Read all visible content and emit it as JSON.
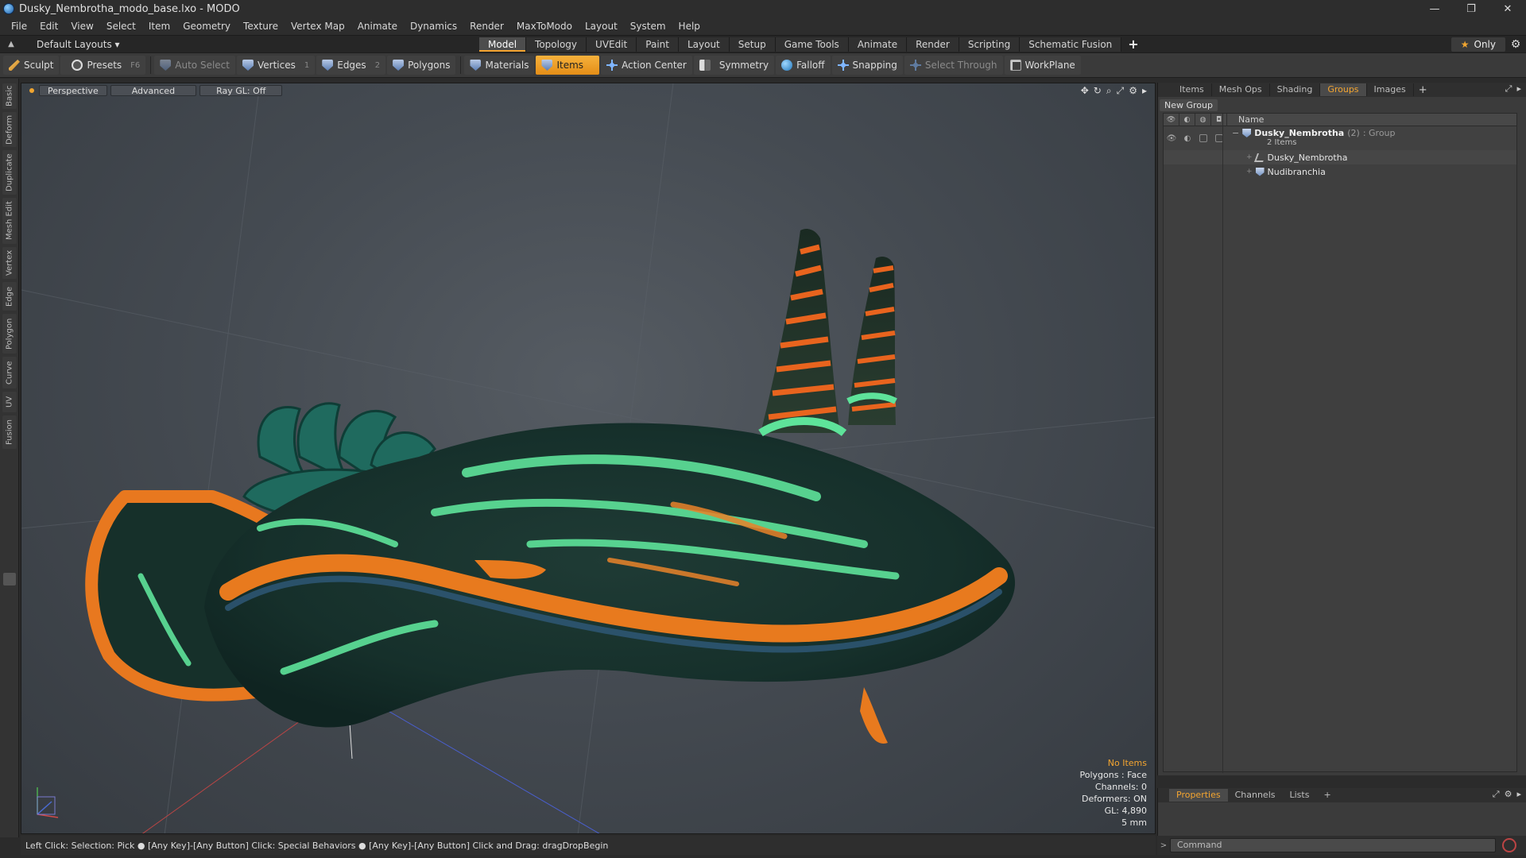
{
  "window": {
    "title": "Dusky_Nembrotha_modo_base.lxo - MODO",
    "controls": [
      "—",
      "❐",
      "✕"
    ]
  },
  "menu": [
    "File",
    "Edit",
    "View",
    "Select",
    "Item",
    "Geometry",
    "Texture",
    "Vertex Map",
    "Animate",
    "Dynamics",
    "Render",
    "MaxToModo",
    "Layout",
    "System",
    "Help"
  ],
  "layoutbar": {
    "layout_select": "Default Layouts ▾",
    "tabs": [
      "Model",
      "Topology",
      "UVEdit",
      "Paint",
      "Layout",
      "Setup",
      "Game Tools",
      "Animate",
      "Render",
      "Scripting",
      "Schematic Fusion"
    ],
    "active_tab": "Model",
    "plus": "+",
    "only_label": "Only"
  },
  "toolbar": {
    "sculpt": "Sculpt",
    "presets": "Presets",
    "presets_key": "F6",
    "auto_select": "Auto Select",
    "vertices": "Vertices",
    "vertices_key": "1",
    "edges": "Edges",
    "edges_key": "2",
    "polygons": "Polygons",
    "materials": "Materials",
    "items": "Items",
    "action_center": "Action Center",
    "symmetry": "Symmetry",
    "falloff": "Falloff",
    "snapping": "Snapping",
    "select_through": "Select Through",
    "workplane": "WorkPlane"
  },
  "left_tabs": [
    "Basic",
    "Deform",
    "Duplicate",
    "Mesh Edit",
    "Vertex",
    "Edge",
    "Polygon",
    "Curve",
    "UV",
    "Fusion"
  ],
  "viewport": {
    "view": "Perspective",
    "mode": "Advanced",
    "raygl": "Ray GL: Off",
    "info": {
      "items": "No Items",
      "polygons": "Polygons : Face",
      "channels": "Channels: 0",
      "deformers": "Deformers: ON",
      "gl": "GL: 4,890",
      "scale": "5 mm"
    }
  },
  "status": "Left Click: Selection: Pick ● [Any Key]-[Any Button] Click: Special Behaviors ● [Any Key]-[Any Button] Click and Drag: dragDropBegin",
  "right_panel": {
    "tabs": [
      "Items",
      "Mesh Ops",
      "Shading",
      "Groups",
      "Images"
    ],
    "active_tab": "Groups",
    "plus": "+",
    "new_group": "New Group",
    "name_header": "Name",
    "group": {
      "name": "Dusky_Nembrotha",
      "count": "(2)",
      "type": ": Group",
      "sub": "2 Items",
      "children": [
        "Dusky_Nembrotha",
        "Nudibranchia"
      ]
    }
  },
  "properties": {
    "tabs": [
      "Properties",
      "Channels",
      "Lists"
    ],
    "active_tab": "Properties",
    "plus": "+"
  },
  "command": {
    "placeholder": "Command"
  },
  "colors": {
    "accent": "#f4a530",
    "viewport_bg": "#474d54"
  }
}
